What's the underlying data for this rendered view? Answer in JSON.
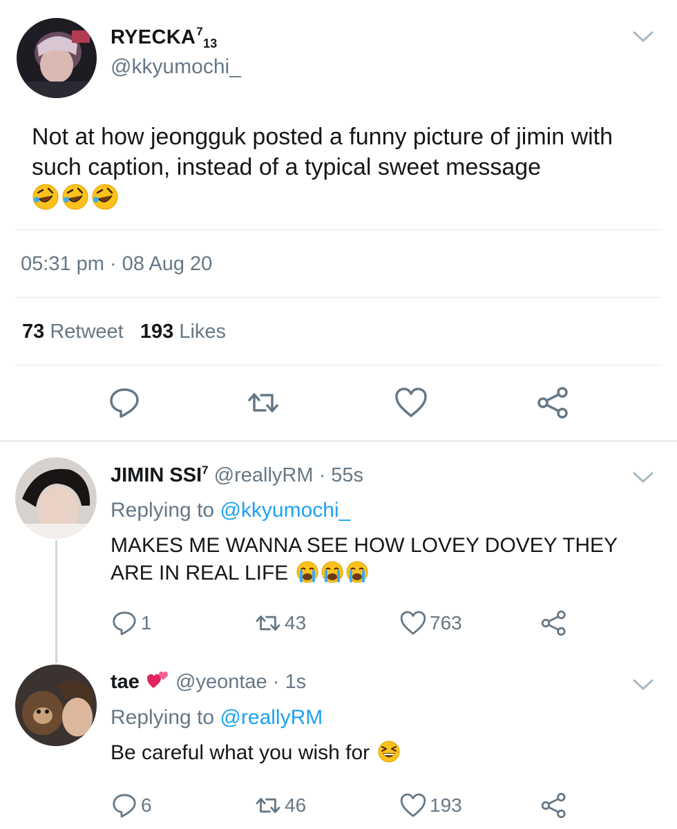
{
  "main_tweet": {
    "display_name": "RYECKA",
    "name_sup": "7",
    "name_sub": "13",
    "handle": "@kkyumochi_",
    "text": "Not at how jeongguk posted a funny picture of jimin with such caption, instead of a typical sweet message",
    "emojis": [
      "rofl-emoji",
      "rofl-emoji",
      "rofl-emoji"
    ],
    "timestamp": "05:31 pm · 08 Aug 20",
    "retweet_count": "73",
    "retweet_label": "Retweet",
    "like_count": "193",
    "like_label": "Likes"
  },
  "replies": [
    {
      "display_name": "JIMIN SSI",
      "name_sup": "7",
      "handle_time": "@reallyRM · 55s",
      "replying_prefix": "Replying to",
      "replying_to": "@kkyumochi_",
      "text": "MAKES ME WANNA SEE HOW LOVEY DOVEY THEY ARE IN REAL LIFE",
      "emojis": [
        "crying-emoji",
        "crying-emoji",
        "crying-emoji"
      ],
      "reply_count": "1",
      "retweet_count": "43",
      "like_count": "763"
    },
    {
      "display_name": "tae",
      "name_emoji": "revolving-hearts-emoji",
      "handle_time": "@yeontae · 1s",
      "replying_prefix": "Replying to",
      "replying_to": "@reallyRM",
      "text": "Be careful what you wish for",
      "emojis": [
        "laughing-squint-emoji"
      ],
      "reply_count": "6",
      "retweet_count": "46",
      "like_count": "193"
    }
  ],
  "colors": {
    "text": "#14171a",
    "secondary": "#657786",
    "link": "#1da1f2",
    "divider": "#e1e8ed",
    "icon": "#657786"
  }
}
